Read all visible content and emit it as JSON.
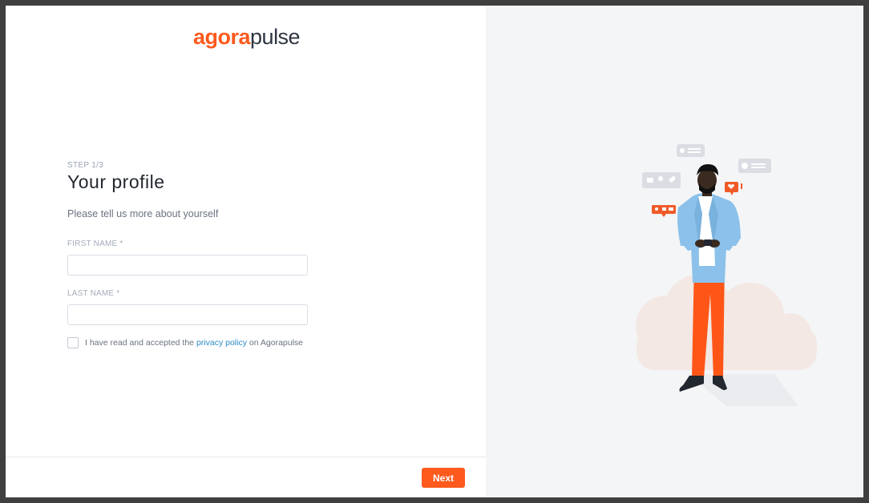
{
  "logo": {
    "part1": "agora",
    "part2": "pulse"
  },
  "form": {
    "step": "STEP 1/3",
    "title": "Your profile",
    "subtitle": "Please tell us more about yourself",
    "first_name_label": "FIRST NAME *",
    "last_name_label": "LAST NAME *",
    "first_name_value": "",
    "last_name_value": "",
    "consent_prefix": "I have read and accepted the ",
    "consent_link": "privacy policy",
    "consent_suffix": " on Agorapulse",
    "consent_checked": false
  },
  "footer": {
    "next_label": "Next"
  },
  "colors": {
    "brand": "#fe5a1d",
    "link": "#2d8ac7",
    "panel": "#f4f5f7"
  },
  "illustration": {
    "icon": "person-with-phone-social-notifications-illustration"
  }
}
